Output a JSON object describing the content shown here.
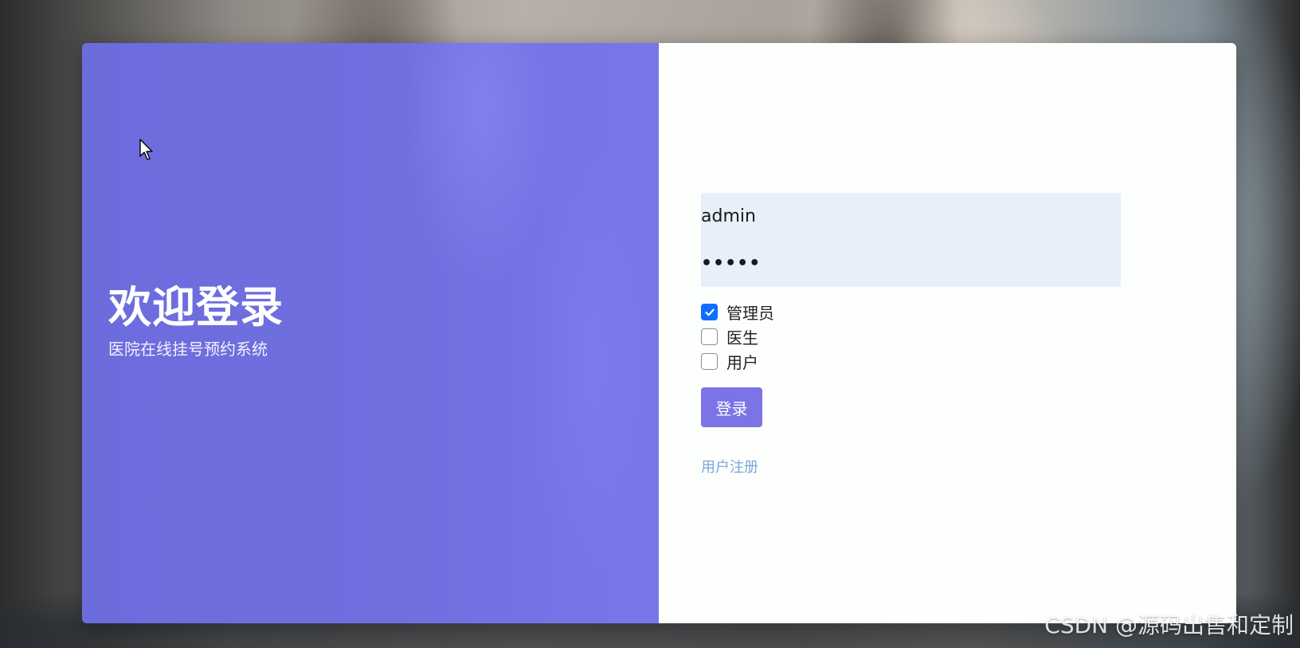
{
  "welcome": {
    "title": "欢迎登录",
    "subtitle": "医院在线挂号预约系统"
  },
  "login_form": {
    "username_value": "admin",
    "password_mask": "•••••",
    "roles": [
      {
        "label": "管理员",
        "checked": true
      },
      {
        "label": "医生",
        "checked": false
      },
      {
        "label": "用户",
        "checked": false
      }
    ],
    "submit_label": "登录",
    "register_link": "用户注册"
  },
  "watermark": "CSDN @源码出售和定制",
  "colors": {
    "accent": "#7c73e6",
    "left_panel": "#6f6fe0",
    "checkbox_checked": "#0d6efd",
    "link": "#7aa6dd",
    "input_bg": "#e7effb"
  },
  "icons": [
    "mouse-cursor-icon",
    "checkmark-icon"
  ]
}
